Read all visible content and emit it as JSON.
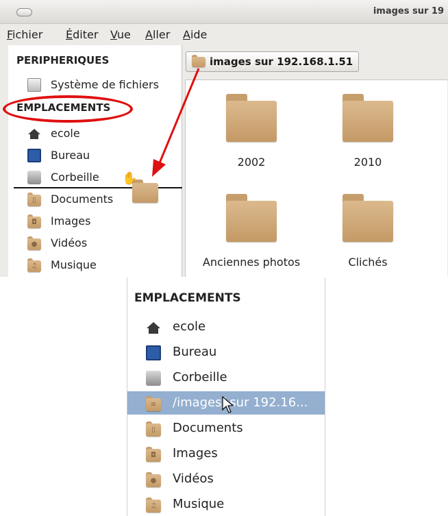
{
  "window": {
    "title": "images sur 19",
    "menu": [
      "Fichier",
      "Éditer",
      "Vue",
      "Aller",
      "Aide"
    ]
  },
  "sidebar": {
    "devices_header": "PERIPHERIQUES",
    "devices": [
      {
        "label": "Système de fichiers",
        "icon": "hard-drive-icon"
      }
    ],
    "places_header": "EMPLACEMENTS",
    "places": [
      {
        "label": "ecole",
        "icon": "home-icon"
      },
      {
        "label": "Bureau",
        "icon": "desktop-icon"
      },
      {
        "label": "Corbeille",
        "icon": "trash-icon"
      },
      {
        "label": "Documents",
        "icon": "documents-folder-icon"
      },
      {
        "label": "Images",
        "icon": "pictures-folder-icon"
      },
      {
        "label": "Vidéos",
        "icon": "videos-folder-icon"
      },
      {
        "label": "Musique",
        "icon": "music-folder-icon"
      }
    ]
  },
  "location": {
    "label": "images sur 192.168.1.51"
  },
  "folders": [
    {
      "name": "2002"
    },
    {
      "name": "2010"
    },
    {
      "name": "Anciennes photos"
    },
    {
      "name": "Clichés"
    }
  ],
  "zoomed_panel": {
    "header": "EMPLACEMENTS",
    "items": [
      {
        "label": "ecole",
        "icon": "home-icon",
        "selected": false
      },
      {
        "label": "Bureau",
        "icon": "desktop-icon",
        "selected": false
      },
      {
        "label": "Corbeille",
        "icon": "trash-icon",
        "selected": false
      },
      {
        "label": "/images/ sur 192.16...",
        "icon": "network-folder-icon",
        "selected": true
      },
      {
        "label": "Documents",
        "icon": "documents-folder-icon",
        "selected": false
      },
      {
        "label": "Images",
        "icon": "pictures-folder-icon",
        "selected": false
      },
      {
        "label": "Vidéos",
        "icon": "videos-folder-icon",
        "selected": false
      },
      {
        "label": "Musique",
        "icon": "music-folder-icon",
        "selected": false
      }
    ]
  },
  "colors": {
    "annotation_red": "#e01010",
    "selection_blue": "#94afcf",
    "folder_tan": "#d4b07f"
  }
}
